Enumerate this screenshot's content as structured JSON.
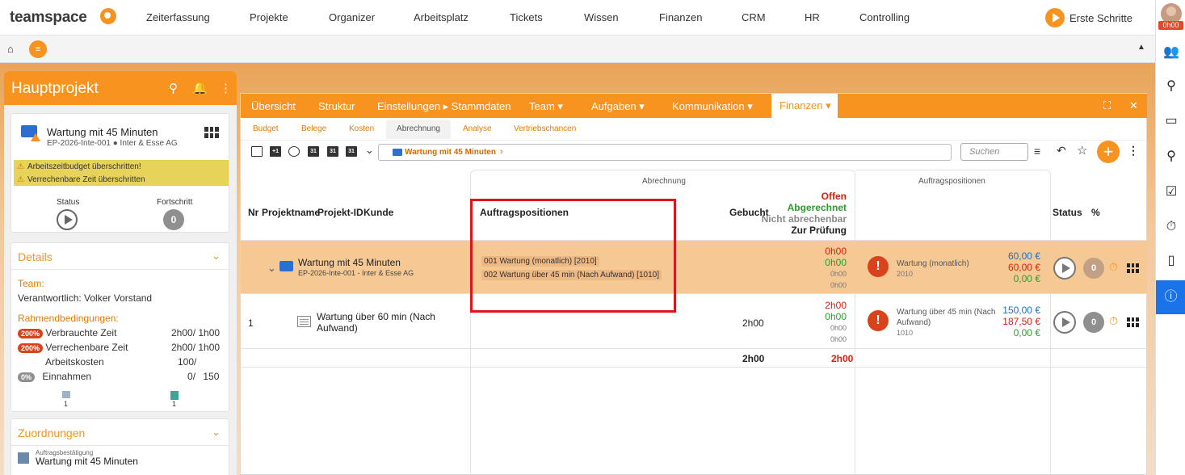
{
  "app": {
    "logo": "teamspace"
  },
  "nav": [
    "Zeiterfassung",
    "Projekte",
    "Organizer",
    "Arbeitsplatz",
    "Tickets",
    "Wissen",
    "Finanzen",
    "CRM",
    "HR",
    "Controlling"
  ],
  "erste_schritte": "Erste Schritte",
  "user": {
    "timer": "0h00"
  },
  "left_panel": {
    "title": "Hauptprojekt",
    "project": {
      "name": "Wartung mit 45 Minuten",
      "sub": "EP-2026-Inte-001 ● Inter & Esse AG"
    },
    "warnings": [
      "Arbeitszeitbudget überschritten!",
      "Verrechenbare Zeit überschritten"
    ],
    "status_label": "Status",
    "progress_label": "Fortschritt",
    "progress_value": "0",
    "details": {
      "title": "Details",
      "team_label": "Team:",
      "responsible": "Verantwortlich: Volker Vorstand",
      "conditions_label": "Rahmendbedingungen:",
      "rows": [
        {
          "badge": "200%",
          "label": "Verbrauchte Zeit",
          "v1": "2h00",
          "v2": "1h00"
        },
        {
          "badge": "200%",
          "label": "Verrechenbare Zeit",
          "v1": "2h00",
          "v2": "1h00"
        },
        {
          "badge": "",
          "label": "Arbeitskosten",
          "v1": "100",
          "v2": ""
        },
        {
          "badge": "0%",
          "label": "Einnahmen",
          "v1": "0",
          "v2": "150"
        }
      ],
      "count1": "1",
      "count2": "1"
    },
    "zuordnungen": {
      "title": "Zuordnungen",
      "type": "Auftragsbestätigung",
      "name": "Wartung mit 45 Minuten"
    }
  },
  "window": {
    "tabs": [
      "Übersicht",
      "Struktur",
      "Einstellungen ▸ Stammdaten",
      "Team ▾",
      "Aufgaben ▾",
      "Kommunikation ▾"
    ],
    "active_tab": "Finanzen ▾",
    "subtabs": [
      "Budget",
      "Belege",
      "Kosten",
      "Abrechnung",
      "Analyse",
      "Vertriebschancen"
    ],
    "breadcrumb": "Wartung mit 45 Minuten",
    "search_placeholder": "Suchen"
  },
  "table": {
    "group_abrechnung": "Abrechnung",
    "group_auftragspositionen": "Auftragspositionen",
    "headers": {
      "nr": "Nr",
      "projektname": "Projektname",
      "projekt_id": "Projekt-ID",
      "kunde": "Kunde",
      "auftragspositionen": "Auftragspositionen",
      "gebucht": "Gebucht",
      "offen": "Offen",
      "abgerechnet": "Abgerechnet",
      "nicht_abrechenbar": "Nicht abrechenbar",
      "zur_pruefung": "Zur Prüfung",
      "status": "Status",
      "percent": "%"
    },
    "rows": [
      {
        "nr": "",
        "name": "Wartung mit 45 Minuten",
        "sub": "EP-2026-Inte-001 - Inter & Esse AG",
        "positions": [
          "001 Wartung (monatlich) [2010]",
          "002 Wartung über 45 min (Nach Aufwand) [1010]"
        ],
        "gebucht": "",
        "offen": "0h00",
        "abgerechnet": "0h00",
        "nicht": "0h00",
        "pruefung": "0h00",
        "auf_text": "Wartung (monatlich)",
        "auf_code": "2010",
        "amount1": "60,00 €",
        "amount2": "60,00 €",
        "amount3": "0,00 €",
        "progress": "0"
      },
      {
        "nr": "1",
        "name": "Wartung über 60 min (Nach Aufwand)",
        "sub": "",
        "positions": [],
        "gebucht": "2h00",
        "offen": "2h00",
        "abgerechnet": "0h00",
        "nicht": "0h00",
        "pruefung": "0h00",
        "auf_text": "Wartung über 45 min (Nach Aufwand)",
        "auf_code": "1010",
        "amount1": "150,00 €",
        "amount2": "187,50 €",
        "amount3": "0,00 €",
        "progress": "0"
      }
    ],
    "total_gebucht": "2h00",
    "total_offen": "2h00"
  }
}
